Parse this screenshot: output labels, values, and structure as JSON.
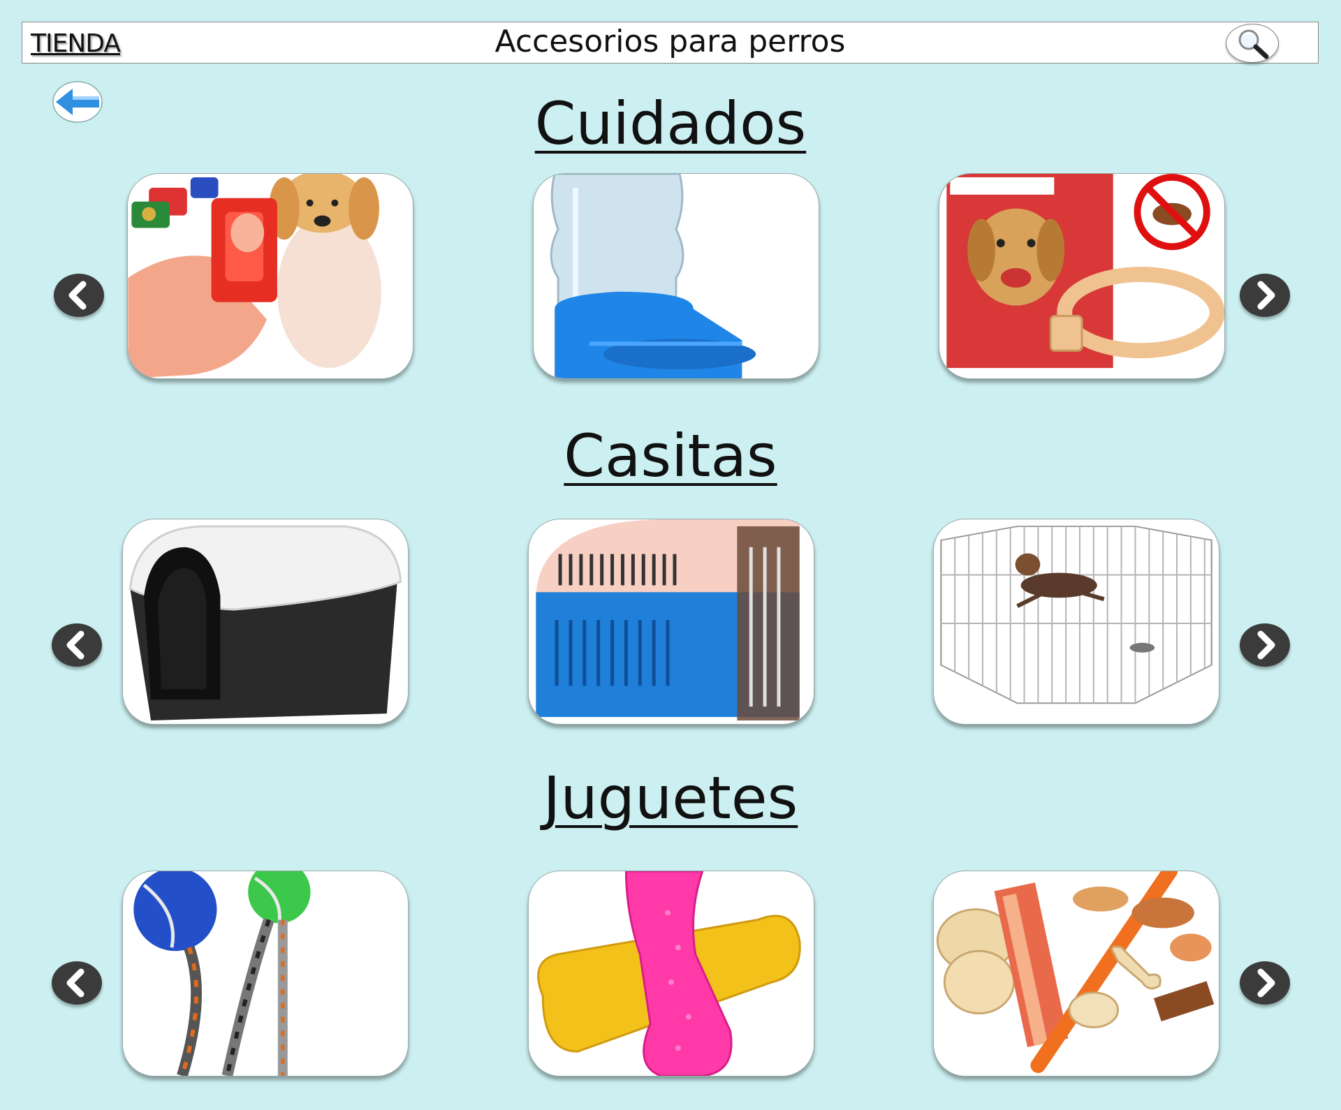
{
  "header": {
    "brand": "TIENDA",
    "title": "Accesorios para perros",
    "search_icon": "magnifier-icon"
  },
  "nav": {
    "back_icon": "back-arrow-icon"
  },
  "sections": [
    {
      "title": "Cuidados",
      "items": [
        "clicker-training",
        "water-dispenser",
        "flea-collar"
      ]
    },
    {
      "title": "Casitas",
      "items": [
        "dog-house",
        "pet-carrier",
        "playpen"
      ]
    },
    {
      "title": "Juguetes",
      "items": [
        "rope-ball-toy",
        "rubber-bone-toy",
        "dog-treats"
      ]
    }
  ],
  "colors": {
    "background": "#ccf0f1",
    "arrow": "#3b3b3b",
    "back_arrow": "#2f8fe0"
  }
}
